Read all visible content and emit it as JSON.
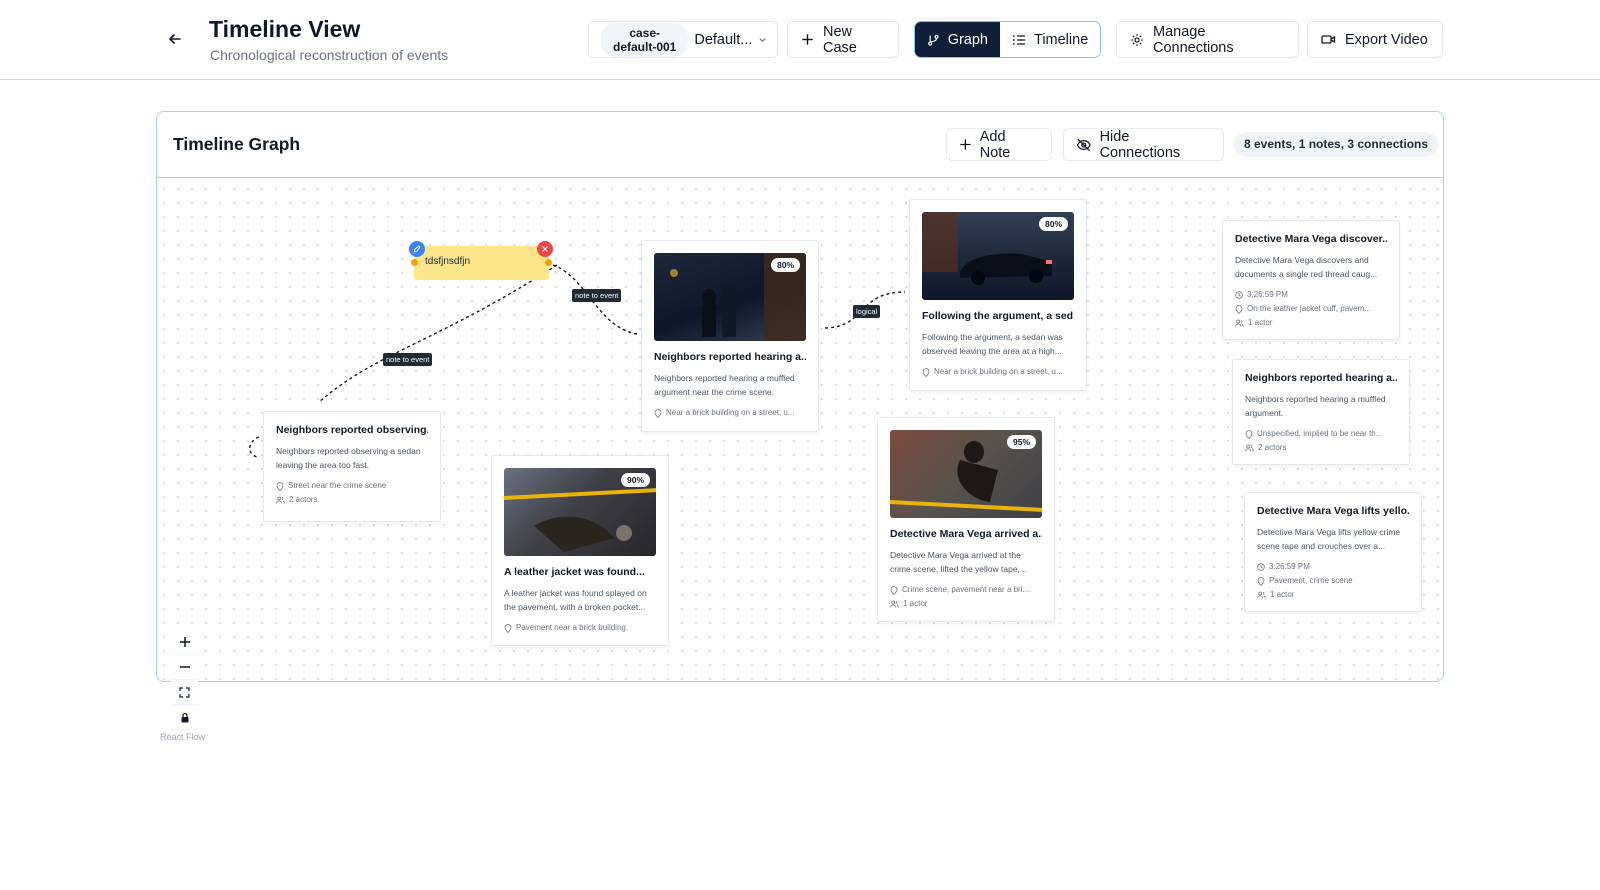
{
  "header": {
    "title": "Timeline View",
    "subtitle": "Chronological reconstruction of events",
    "case_id": "case-\ndefault-001",
    "case_name": "Default...",
    "new_case": "New Case",
    "graph_tab": "Graph",
    "timeline_tab": "Timeline",
    "manage_connections": "Manage Connections",
    "export_video": "Export Video"
  },
  "panel": {
    "title": "Timeline Graph",
    "add_note": "Add Note",
    "hide_connections": "Hide Connections",
    "stats": "8 events, 1 notes, 3 connections"
  },
  "note": {
    "text": "tdsfjnsdfjn"
  },
  "edge_labels": [
    "note to event",
    "note to event",
    "logical"
  ],
  "events": [
    {
      "title": "Neighbors reported observing...",
      "desc": "Neighbors reported observing a sedan leaving the area too fast.",
      "location": "Street near the crime scene",
      "actors": "2 actors"
    },
    {
      "title": "A leather jacket was found...",
      "confidence": "90%",
      "desc": "A leather jacket was found splayed on the pavement, with a broken pocket...",
      "location": "Pavement near a brick building."
    },
    {
      "title": "Neighbors reported hearing a...",
      "confidence": "80%",
      "desc": "Neighbors reported hearing a muffled argument near the crime scene.",
      "location": "Near a brick building on a street, u..."
    },
    {
      "title": "Following the argument, a sed...",
      "confidence": "80%",
      "desc": "Following the argument, a sedan was observed leaving the area at a high...",
      "location": "Near a brick building on a street, u..."
    },
    {
      "title": "Detective Mara Vega arrived a...",
      "confidence": "95%",
      "desc": "Detective Mara Vega arrived at the crime scene, lifted the yellow tape,...",
      "location": "Crime scene, pavement near a bri...",
      "actors": "1 actor"
    },
    {
      "title": "Detective Mara Vega discover...",
      "desc": "Detective Mara Vega discovers and documents a single red thread caug...",
      "time": "3:26:59 PM",
      "location": "On the leather jacket cuff, pavem...",
      "actors": "1 actor"
    },
    {
      "title": "Neighbors reported hearing a...",
      "desc": "Neighbors reported hearing a muffled argument.",
      "location": "Unspecified, implied to be near th...",
      "actors": "2 actors"
    },
    {
      "title": "Detective Mara Vega lifts yello...",
      "desc": "Detective Mara Vega lifts yellow crime scene tape and crouches over a...",
      "time": "3:26:59 PM",
      "location": "Pavement, crime scene",
      "actors": "1 actor"
    }
  ],
  "attribution": "React Flow",
  "colors": {
    "accent": "#0f1f3a",
    "border": "#9fd3e8",
    "note": "#fde68a"
  }
}
